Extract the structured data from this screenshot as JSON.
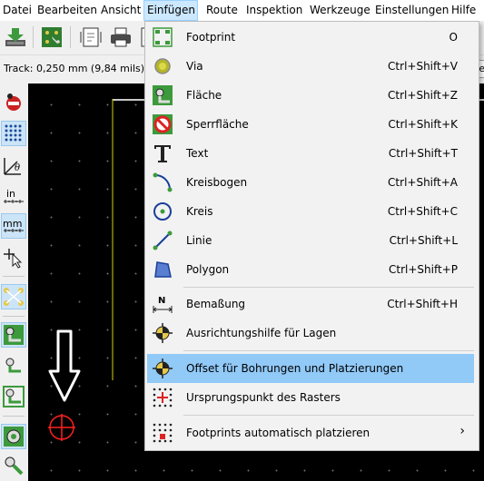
{
  "menubar": {
    "items": [
      "Datei",
      "Bearbeiten",
      "Ansicht",
      "Einfügen",
      "Route",
      "Inspektion",
      "Werkzeuge",
      "Einstellungen",
      "Hilfe"
    ],
    "active_index": 3
  },
  "auxbar": {
    "track": "Track: 0,250 mm (9,84 mils) *",
    "right_fragment": "te"
  },
  "insert_menu": {
    "items": [
      {
        "label": "Footprint",
        "shortcut": "O",
        "icon": "footprint-icon"
      },
      {
        "label": "Via",
        "shortcut": "Ctrl+Shift+V",
        "icon": "via-icon"
      },
      {
        "label": "Fläche",
        "shortcut": "Ctrl+Shift+Z",
        "icon": "zone-icon"
      },
      {
        "label": "Sperrfläche",
        "shortcut": "Ctrl+Shift+K",
        "icon": "keepout-icon"
      },
      {
        "label": "Text",
        "shortcut": "Ctrl+Shift+T",
        "icon": "text-icon"
      },
      {
        "label": "Kreisbogen",
        "shortcut": "Ctrl+Shift+A",
        "icon": "arc-icon"
      },
      {
        "label": "Kreis",
        "shortcut": "Ctrl+Shift+C",
        "icon": "circle-icon"
      },
      {
        "label": "Linie",
        "shortcut": "Ctrl+Shift+L",
        "icon": "line-icon"
      },
      {
        "label": "Polygon",
        "shortcut": "Ctrl+Shift+P",
        "icon": "polygon-icon"
      },
      {
        "label": "Bemaßung",
        "shortcut": "Ctrl+Shift+H",
        "icon": "dimension-icon"
      },
      {
        "label": "Ausrichtungshilfe für Lagen",
        "shortcut": "",
        "icon": "layer-alignment-target-icon"
      },
      {
        "label": "Offset für Bohrungen und Platzierungen",
        "shortcut": "",
        "icon": "drill-offset-icon"
      },
      {
        "label": "Ursprungspunkt des Rasters",
        "shortcut": "",
        "icon": "grid-origin-icon"
      },
      {
        "label": "Footprints automatisch platzieren",
        "shortcut": "",
        "icon": "autoplace-icon",
        "submenu_arrow": "›"
      }
    ],
    "highlighted_index": 11
  },
  "colors": {
    "menu_highlight": "#91c9f7",
    "menubar_active": "#cce8ff",
    "canvas_bg": "#000000",
    "origin_marker": "#ff2020",
    "tool_green": "#3c9a3c"
  }
}
